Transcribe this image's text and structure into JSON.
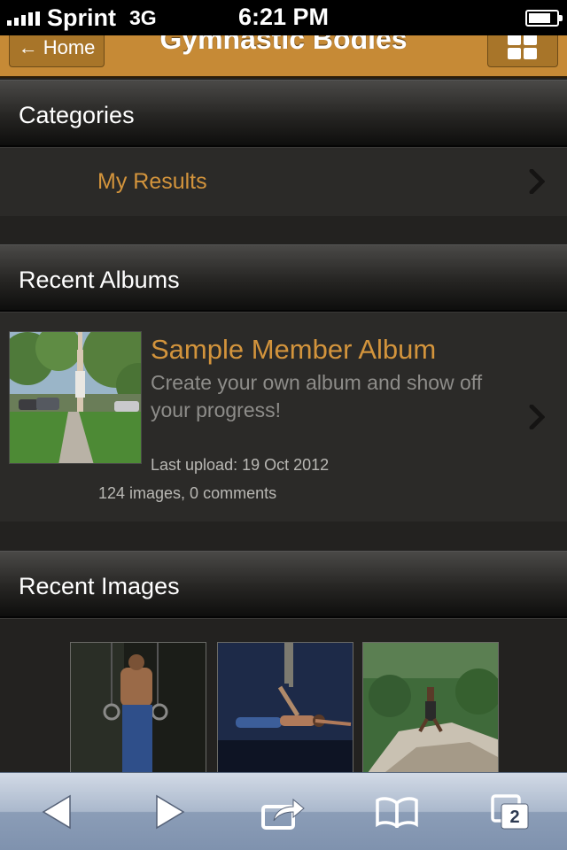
{
  "status_bar": {
    "carrier": "Sprint",
    "network": "3G",
    "time": "6:21 PM"
  },
  "header": {
    "back_label": "← Home",
    "title": "Gymnastic Bodies",
    "menu_icon": "grid-icon"
  },
  "sections": {
    "categories": {
      "title": "Categories",
      "items": [
        {
          "label": "My Results"
        }
      ]
    },
    "recent_albums": {
      "title": "Recent Albums",
      "albums": [
        {
          "title": "Sample Member Album",
          "description": "Create your own album and show off your progress!",
          "last_upload": "Last upload: 19 Oct 2012",
          "counts": "124 images, 0 comments"
        }
      ]
    },
    "recent_images": {
      "title": "Recent Images",
      "image_count_visible": 3
    }
  },
  "toolbar": {
    "tab_count": "2",
    "icons": [
      "back-arrow-icon",
      "forward-arrow-icon",
      "share-icon",
      "bookmarks-icon",
      "tabs-icon"
    ]
  },
  "colors": {
    "accent": "#d3943c",
    "header_bg": "#c68a36",
    "page_bg": "#232220"
  }
}
